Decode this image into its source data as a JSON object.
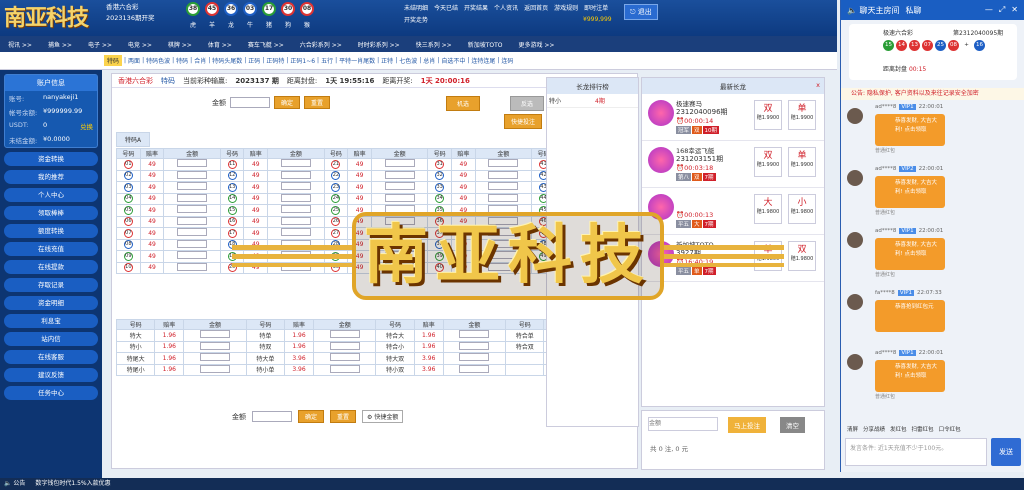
{
  "header": {
    "logo": "南亚科技",
    "lottery_name": "香港六合彩",
    "lottery_period": "2023136期开奖",
    "balls": [
      {
        "n": "38",
        "c": "g"
      },
      {
        "n": "45",
        "c": "r"
      },
      {
        "n": "36",
        "c": "b"
      },
      {
        "n": "03",
        "c": "b"
      },
      {
        "n": "17",
        "c": "g"
      },
      {
        "n": "30",
        "c": "r"
      },
      {
        "n": "08",
        "c": "r"
      }
    ],
    "zodiac": [
      "虎",
      "羊",
      "龙",
      "牛",
      "猪",
      "狗",
      "猴"
    ],
    "links": [
      "未结明细",
      "今天已结",
      "开奖结果",
      "个人资讯",
      "返回首页",
      "游戏规则",
      "即时注单",
      "开奖走势"
    ],
    "balance": "¥999,999",
    "exit": "退出"
  },
  "menu": [
    "视讯 >>",
    "捕鱼 >>",
    "电子 >>",
    "电竞 >>",
    "棋牌 >>",
    "体育 >>",
    "赛车飞艇 >>",
    "六合彩系列 >>",
    "时时彩系列 >>",
    "快三系列 >>",
    "新加坡TOTO",
    "更多游戏 >>"
  ],
  "subtabs": [
    "特码",
    "两面",
    "特码色波",
    "特码",
    "合肖",
    "特码头尾数",
    "正码",
    "正码特",
    "正码1~6",
    "五行",
    "平特一肖尾数",
    "正特",
    "七色波",
    "总肖",
    "自选不中",
    "连特连尾",
    "连码"
  ],
  "account": {
    "title": "账户信息",
    "rows": [
      {
        "k": "账号:",
        "v": "nanyakeji1"
      },
      {
        "k": "帐号余额:",
        "v": "¥999999.99"
      },
      {
        "k": "USDT:",
        "v": "0"
      },
      {
        "k": "未结金额:",
        "v": "¥0.0000"
      }
    ],
    "usdt_note": "兑换"
  },
  "nav": [
    "资金转换",
    "我的推荐",
    "个人中心",
    "领取棒棒",
    "额度转换",
    "在线充值",
    "在线提款",
    "存取记录",
    "资金明细",
    "利息宝",
    "站内信",
    "在线客服",
    "建议反馈",
    "任务中心"
  ],
  "main": {
    "lottery": "香港六合彩",
    "tab": "特码",
    "hint": "当前彩种输赢:",
    "period": "2023137 期",
    "close_label": "距离封盘:",
    "close_time": "1天 19:55:16",
    "open_label": "距离开奖:",
    "open_time": "1天 20:00:16",
    "amount_label": "金额",
    "confirm": "确定",
    "reset": "重置",
    "mode1": "机选",
    "mode2": "反选",
    "quick": "快捷投注",
    "sheet_tab": "特码A",
    "col_h": [
      "号码",
      "赔率",
      "金额"
    ],
    "odds": "49",
    "side_rows": [
      [
        "特大",
        "1.96",
        "特单",
        "1.96",
        "特合大",
        "1.96",
        "特合单",
        "1.96"
      ],
      [
        "特小",
        "1.96",
        "特双",
        "1.96",
        "特合小",
        "1.96",
        "特合双",
        "1.96"
      ],
      [
        "特尾大",
        "1.96",
        "特大单",
        "3.96",
        "特大双",
        "3.96",
        "",
        ""
      ],
      [
        "特尾小",
        "1.96",
        "特小单",
        "3.96",
        "特小双",
        "3.96",
        "",
        ""
      ]
    ],
    "bottom_amount": "金额",
    "bottom_confirm": "确定",
    "bottom_reset": "重置",
    "bottom_quick": "快捷金额"
  },
  "rank": {
    "title": "长龙排行榜",
    "row_label": "特小",
    "row_val": "4期"
  },
  "news": {
    "title": "最新长龙",
    "close": "x",
    "cards": [
      {
        "name": "极速赛马",
        "id": "2312040096期",
        "time": "00:00:14",
        "tags": [
          "冠军",
          "双",
          "10期"
        ],
        "b1": "双",
        "o1": "赔1.9900",
        "b2": "单",
        "o2": "赔1.9900"
      },
      {
        "name": "168幸运飞艇",
        "id": "231203151期",
        "time": "00:03:18",
        "tags": [
          "第八",
          "双",
          "7期"
        ],
        "b1": "双",
        "o1": "赔1.9900",
        "b2": "单",
        "o2": "赔1.9900"
      },
      {
        "name": "",
        "id": "",
        "time": "00:00:13",
        "tags": [
          "平五",
          "大",
          "7期"
        ],
        "b1": "大",
        "o1": "赔1.9800",
        "b2": "小",
        "o2": "赔1.9800"
      },
      {
        "name": "新加坡TOTO",
        "id": "3927期",
        "time": "16:40:19",
        "tags": [
          "平五",
          "单",
          "7期"
        ],
        "b1": "单",
        "o1": "赔1.9800",
        "b2": "双",
        "o2": "赔1.9800"
      }
    ]
  },
  "betbox": {
    "placeholder": "金额",
    "submit": "马上投注",
    "clear": "清空",
    "total": "共 0 注, 0 元"
  },
  "chat": {
    "room": "聊天主房间",
    "private": "私聊",
    "result_name": "极速六合彩",
    "result_period": "第2312040095期",
    "result_balls": [
      "15",
      "14",
      "13",
      "07",
      "25",
      "08",
      "+",
      "16"
    ],
    "countdown": "距离封盘",
    "countdown_time": "00:15",
    "notice": "公告: 隐私保护, 客户资料以及来往记录安全加密",
    "messages": [
      {
        "user": "ad****8",
        "vip": "VIP1",
        "time": "22:00:01",
        "text": "恭喜发财, 大吉大利! 点击领取",
        "label": "普通红包"
      },
      {
        "user": "ad****8",
        "vip": "VIP2",
        "time": "22:00:01",
        "text": "恭喜发财, 大吉大利! 点击领取",
        "label": "普通红包"
      },
      {
        "user": "ad****8",
        "vip": "VIP1",
        "time": "22:00:01",
        "text": "恭喜发财, 大吉大利! 点击领取",
        "label": "普通红包"
      },
      {
        "user": "fa****8",
        "vip": "VIP1",
        "time": "22:07:33",
        "text": "恭喜抢到红包元",
        "label": ""
      },
      {
        "user": "ad****8",
        "vip": "VIP1",
        "time": "22:00:01",
        "text": "恭喜发财, 大吉大利! 点击领取",
        "label": "普通红包"
      }
    ],
    "tools": [
      "清屏",
      "分享战绩",
      "发红包",
      "扫雷红包",
      "口令红包"
    ],
    "input_placeholder": "发言条件: 近1天充值不少于100元。",
    "send": "发送"
  },
  "status": {
    "notice_label": "公告",
    "notice_text": "数字钱包时代1.5%入款优惠"
  },
  "watermark": "南亚科技"
}
